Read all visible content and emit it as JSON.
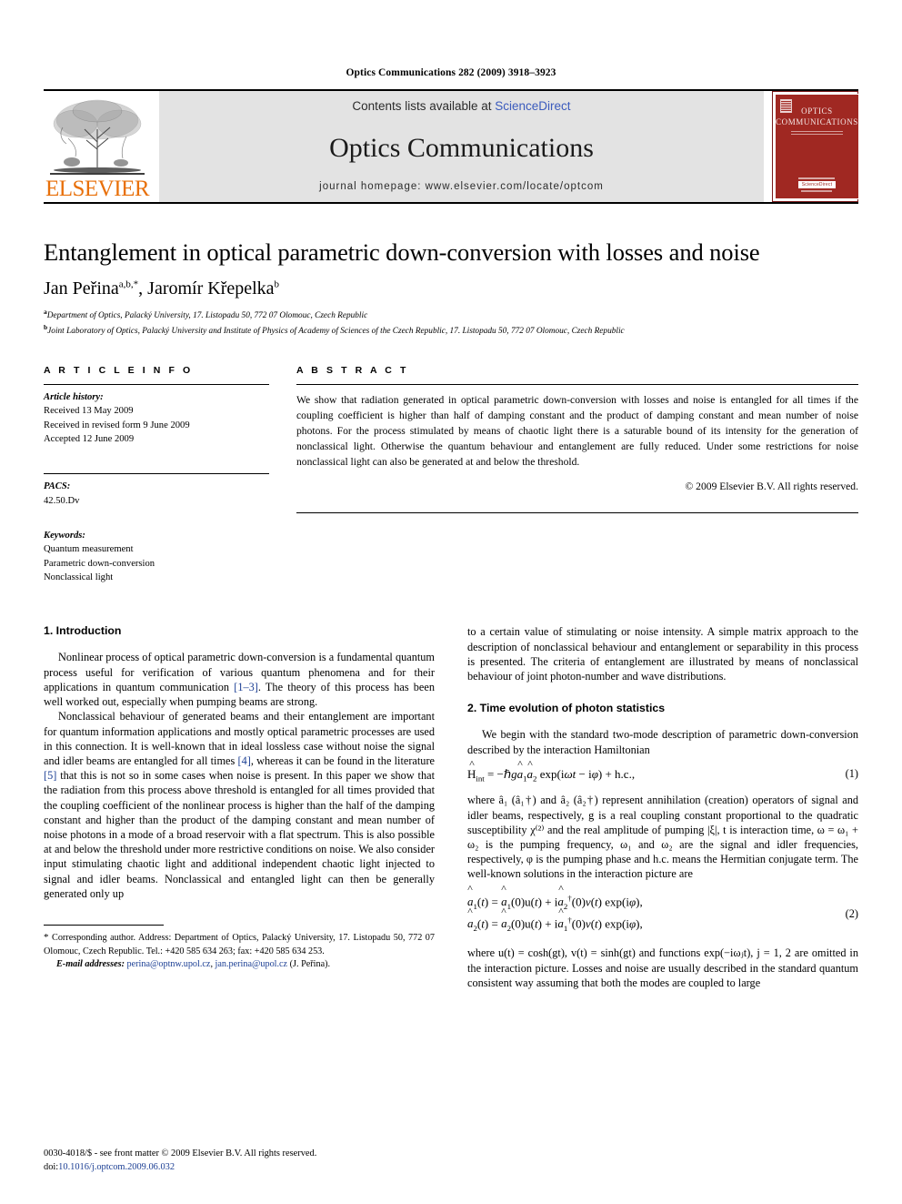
{
  "running_head": "Optics Communications 282 (2009) 3918–3923",
  "masthead": {
    "publisher_name": "ELSEVIER",
    "contents_prefix": "Contents lists available at",
    "contents_link": "ScienceDirect",
    "journal_name": "Optics Communications",
    "homepage_line": "journal homepage: www.elsevier.com/locate/optcom",
    "cover": {
      "line1": "Optics",
      "line2": "Communications"
    }
  },
  "title": "Entanglement in optical parametric down-conversion with losses and noise",
  "authors": {
    "a1_name": "Jan Peřina",
    "a1_sup": "a,b,*",
    "separator": ", ",
    "a2_name": "Jaromír Křepelka",
    "a2_sup": "b"
  },
  "affiliations": [
    {
      "sup": "a",
      "text": "Department of Optics, Palacký University, 17. Listopadu 50, 772 07 Olomouc, Czech Republic"
    },
    {
      "sup": "b",
      "text": "Joint Laboratory of Optics, Palacký University and Institute of Physics of Academy of Sciences of the Czech Republic, 17. Listopadu 50, 772 07 Olomouc, Czech Republic"
    }
  ],
  "article_info": {
    "heading": "A R T I C L E    I N F O",
    "history_label": "Article history:",
    "history": [
      "Received 13 May 2009",
      "Received in revised form 9 June 2009",
      "Accepted 12 June 2009"
    ],
    "pacs_label": "PACS:",
    "pacs": "42.50.Dv",
    "keywords_label": "Keywords:",
    "keywords": [
      "Quantum measurement",
      "Parametric down-conversion",
      "Nonclassical light"
    ]
  },
  "abstract": {
    "heading": "A B S T R A C T",
    "text": "We show that radiation generated in optical parametric down-conversion with losses and noise is entangled for all times if the coupling coefficient is higher than half of damping constant and the product of damping constant and mean number of noise photons. For the process stimulated by means of chaotic light there is a saturable bound of its intensity for the generation of nonclassical light. Otherwise the quantum behaviour and entanglement are fully reduced. Under some restrictions for noise nonclassical light can also be generated at and below the threshold.",
    "copyright": "© 2009 Elsevier B.V. All rights reserved."
  },
  "sections": {
    "s1_heading": "1. Introduction",
    "s1_p1_a": "Nonlinear process of optical parametric down-conversion is a fundamental quantum process useful for verification of various quantum phenomena and for their applications in quantum communication ",
    "s1_p1_ref": "[1–3]",
    "s1_p1_b": ". The theory of this process has been well worked out, especially when pumping beams are strong.",
    "s1_p2_a": "Nonclassical behaviour of generated beams and their entanglement are important for quantum information applications and mostly optical parametric processes are used in this connection. It is well-known that in ideal lossless case without noise the signal and idler beams are entangled for all times ",
    "s1_p2_ref1": "[4]",
    "s1_p2_b": ", whereas it can be found in the literature ",
    "s1_p2_ref2": "[5]",
    "s1_p2_c": " that this is not so in some cases when noise is present. In this paper we show that the radiation from this process above threshold is entangled for all times provided that the coupling coefficient of the nonlinear process is higher than the half of the damping constant and higher than the product of the damping constant and mean number of noise photons in a mode of a broad reservoir with a flat spectrum. This is also possible at and below the threshold under more restrictive conditions on noise. We also consider input stimulating chaotic light and additional independent chaotic light injected to signal and idler beams. Nonclassical and entangled light can then be generally generated only up",
    "s1_p3": "to a certain value of stimulating or noise intensity. A simple matrix approach to the description of nonclassical behaviour and entanglement or separability in this process is presented. The criteria of entanglement are illustrated by means of nonclassical behaviour of joint photon-number and wave distributions.",
    "s2_heading": "2. Time evolution of photon statistics",
    "s2_p1": "We begin with the standard two-mode description of parametric down-conversion described by the interaction Hamiltonian",
    "s2_p2": "where â₁ (â₁†) and â₂ (â₂†) represent annihilation (creation) operators of signal and idler beams, respectively, g is a real coupling constant proportional to the quadratic susceptibility χ⁽²⁾ and the real amplitude of pumping |ξ|, t is interaction time, ω = ω₁ + ω₂ is the pumping frequency, ω₁ and ω₂ are the signal and idler frequencies, respectively, φ is the pumping phase and h.c. means the Hermitian conjugate term. The well-known solutions in the interaction picture are",
    "s2_p3": "where u(t) = cosh(gt), v(t) = sinh(gt) and functions exp(−iωⱼt), j = 1, 2 are omitted in the interaction picture. Losses and noise are usually described in the standard quantum consistent way assuming that both the modes are coupled to large"
  },
  "equations": {
    "eq1_num": "(1)",
    "eq2_num": "(2)"
  },
  "footnote": {
    "star": "*",
    "text": " Corresponding author. Address: Department of Optics, Palacký University, 17. Listopadu 50, 772 07 Olomouc, Czech Republic. Tel.: +420 585 634 263; fax: +420 585 634 253.",
    "email_label": "E-mail addresses:",
    "email1": "perina@optnw.upol.cz",
    "email_sep": ", ",
    "email2": "jan.perina@upol.cz",
    "email_tail": " (J. Peřina)."
  },
  "page_footer": {
    "line1": "0030-4018/$ - see front matter © 2009 Elsevier B.V. All rights reserved.",
    "doi_label": "doi:",
    "doi_value": "10.1016/j.optcom.2009.06.032"
  },
  "colors": {
    "link": "#1c3f94",
    "sciencedirect": "#3b5bbd",
    "elsevier_orange": "#E8700A",
    "cover_red": "#a02822",
    "band_gray": "#e3e3e3"
  }
}
